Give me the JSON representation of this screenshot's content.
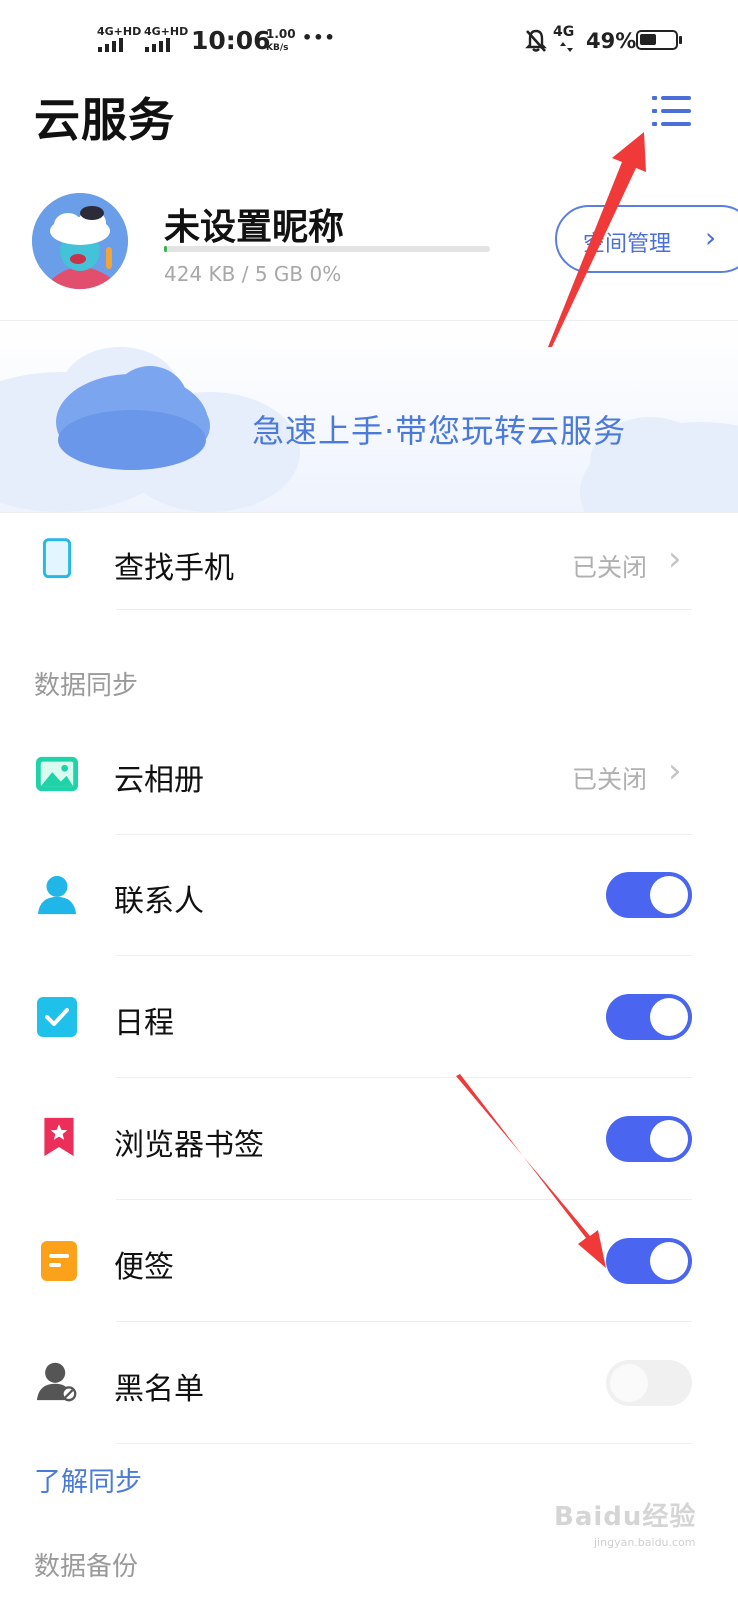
{
  "status_bar": {
    "sim1": "4G+HD",
    "sim2": "4G+HD",
    "time": "10:06",
    "speed_value": "1.00",
    "speed_unit": "KB/s",
    "more": "•••",
    "network": "4G",
    "battery": "49%",
    "battery_level": 0.49
  },
  "header": {
    "title": "云服务",
    "menu_icon": "list-menu-icon"
  },
  "profile": {
    "nickname": "未设置昵称",
    "storage_text": "424 KB / 5 GB 0%",
    "storage_fraction": 0.01,
    "space_button": "空间管理"
  },
  "banner": {
    "text": "急速上手·带您玩转云服务"
  },
  "find_phone": {
    "label": "查找手机",
    "status": "已关闭"
  },
  "data_sync": {
    "section_title": "数据同步",
    "items": [
      {
        "label": "云相册",
        "status": "已关闭",
        "icon": "photo-icon",
        "type": "chevron"
      },
      {
        "label": "联系人",
        "icon": "contact-icon",
        "type": "toggle",
        "on": true
      },
      {
        "label": "日程",
        "icon": "calendar-check-icon",
        "type": "toggle",
        "on": true
      },
      {
        "label": "浏览器书签",
        "icon": "bookmark-icon",
        "type": "toggle",
        "on": true
      },
      {
        "label": "便签",
        "icon": "note-icon",
        "type": "toggle",
        "on": true
      },
      {
        "label": "黑名单",
        "icon": "blocklist-icon",
        "type": "toggle",
        "on": false
      }
    ],
    "learn_link": "了解同步"
  },
  "data_backup": {
    "section_title": "数据备份"
  },
  "watermark": {
    "text": "Baidu经验",
    "sub": "jingyan.baidu.com"
  },
  "colors": {
    "accent": "#4a66f0",
    "link": "#4a7bd8",
    "annotation_arrow": "#f03a3a"
  }
}
